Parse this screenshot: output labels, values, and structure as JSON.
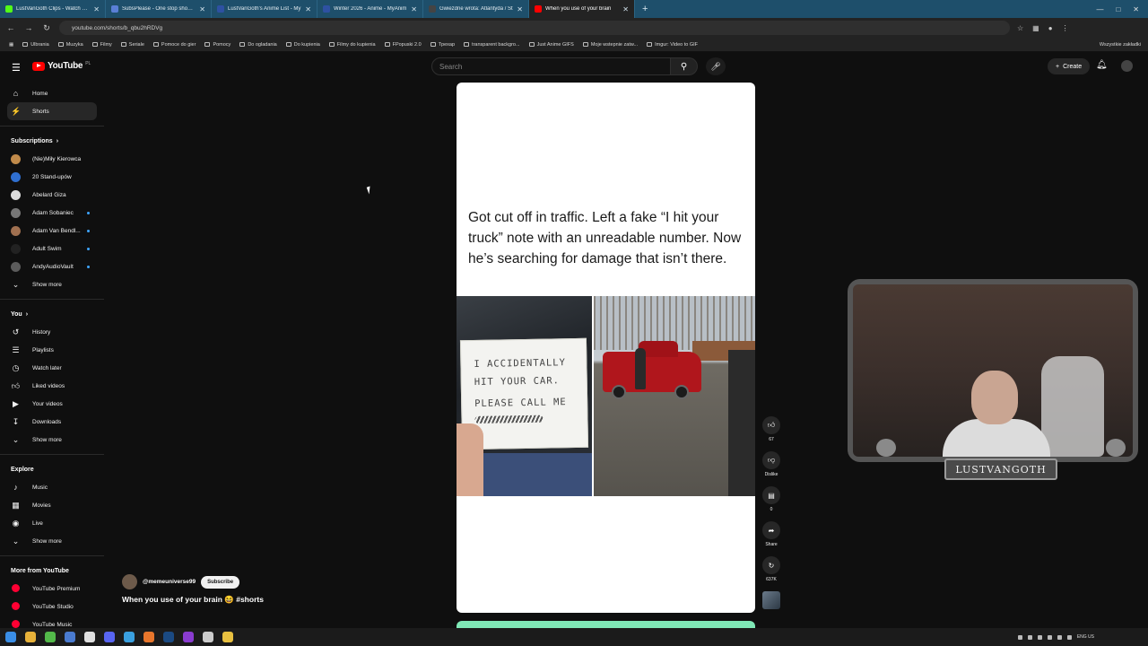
{
  "browser": {
    "tabs": [
      {
        "title": "LustVanGoth Clips - Watch Live",
        "color": "#53fc18"
      },
      {
        "title": "SubsPlease - One stop shop fo",
        "color": "#5a7fd6"
      },
      {
        "title": "LustVanGoth's Anime List - My",
        "color": "#2e51a2"
      },
      {
        "title": "Winter 2026 - Anime - MyAnim",
        "color": "#2e51a2"
      },
      {
        "title": "Gwiezdne wrota: Atlantyda / St",
        "color": "#444444"
      },
      {
        "title": "When you use of your brain",
        "color": "#ff0000",
        "active": true
      }
    ],
    "new_tab": "+",
    "url": "youtube.com/shorts/b_qbu2hRDVg",
    "bookmarks": [
      "Ulbrania",
      "Muzyka",
      "Filmy",
      "Seriale",
      "Pomoce do gier",
      "Pomocy",
      "Do ogladania",
      "Do kupienia",
      "Filmy do kupienia",
      "FPopuski 2.0",
      "Tpexap",
      "transparent backgro...",
      "Just Anime GIFS",
      "Moje wstepnie zatw...",
      "Imgur: Video to GIF"
    ],
    "bookmarks_right": "Wszystkie zakładki"
  },
  "youtube": {
    "logo_text": "YouTube",
    "logo_country": "PL",
    "search_placeholder": "Search",
    "create_label": "Create"
  },
  "sidebar": {
    "main": [
      {
        "label": "Home",
        "icon": "home-icon"
      },
      {
        "label": "Shorts",
        "icon": "shorts-icon",
        "active": true
      }
    ],
    "subscriptions_title": "Subscriptions",
    "subscriptions": [
      {
        "label": "(Nie)Miły Kierowca",
        "color": "#c08a4a",
        "dot": false
      },
      {
        "label": "20 Stand-upów",
        "color": "#2f6fd0",
        "dot": false
      },
      {
        "label": "Abelard Giza",
        "color": "#dddddd",
        "dot": false
      },
      {
        "label": "Adam Sobaniec",
        "color": "#777777",
        "dot": true
      },
      {
        "label": "Adam Van Bendl...",
        "color": "#a07050",
        "dot": true
      },
      {
        "label": "Adult Swim",
        "color": "#222222",
        "dot": true
      },
      {
        "label": "AndyAudioVault",
        "color": "#5c5c5c",
        "dot": true
      }
    ],
    "show_more": "Show more",
    "you_title": "You",
    "you_items": [
      {
        "label": "History",
        "icon": "history-icon"
      },
      {
        "label": "Playlists",
        "icon": "playlists-icon"
      },
      {
        "label": "Watch later",
        "icon": "watch-later-icon"
      },
      {
        "label": "Liked videos",
        "icon": "like-icon"
      },
      {
        "label": "Your videos",
        "icon": "your-videos-icon"
      },
      {
        "label": "Downloads",
        "icon": "download-icon"
      }
    ],
    "explore_title": "Explore",
    "explore_items": [
      {
        "label": "Music",
        "icon": "music-icon"
      },
      {
        "label": "Movies",
        "icon": "movies-icon"
      },
      {
        "label": "Live",
        "icon": "live-icon"
      }
    ],
    "more_title": "More from YouTube",
    "more_items": [
      {
        "label": "YouTube Premium"
      },
      {
        "label": "YouTube Studio"
      },
      {
        "label": "YouTube Music"
      }
    ]
  },
  "short": {
    "caption": "Got cut off in traffic. Left a fake “I hit your  truck” note with an unreadable number.  Now he’s searching for damage that isn’t there.",
    "note_lines": [
      "I ACCIDENTALLY",
      "HIT YOUR CAR.",
      "PLEASE CALL ME"
    ],
    "channel": "@memeuniverse99",
    "subscribe_label": "Subscribe",
    "title": "When you use of your brain 😆 #shorts",
    "likes": "67",
    "dislike_label": "Dislike",
    "comments": "0",
    "share_label": "Share",
    "remix_count": "637K"
  },
  "stream_overlay": {
    "nameplate": "LUSTVANGOTH"
  },
  "taskbar": {
    "lang": "ENG US"
  }
}
